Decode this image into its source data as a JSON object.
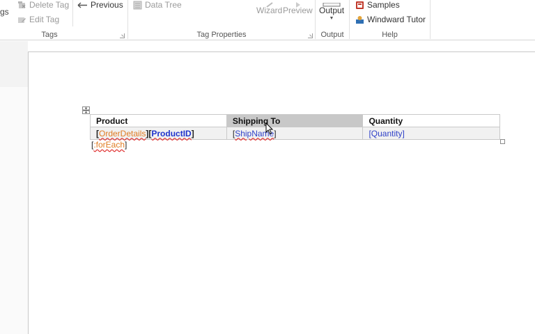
{
  "ribbon": {
    "tags_group": {
      "label": "Tags",
      "partial_left_label": "gs",
      "delete_tag": "Delete Tag",
      "edit_tag": "Edit Tag",
      "previous": "Previous"
    },
    "tag_properties_group": {
      "label": "Tag Properties",
      "data_tree": "Data Tree",
      "wizard": "Wizard",
      "preview": "Preview"
    },
    "output_group": {
      "label": "Output",
      "output_button": "Output"
    },
    "help_group": {
      "label": "Help",
      "samples": "Samples",
      "windward_tutor": "Windward Tutor"
    }
  },
  "document": {
    "table": {
      "headers": [
        "Product",
        "Shipping To",
        "Quantity"
      ],
      "selected_header_index": 1,
      "row": {
        "product_tag1": "OrderDetails",
        "product_tag2": "ProductID",
        "shipping_tag": "ShipName",
        "quantity_tag": "Quantity"
      }
    },
    "foreach_tag": ":forEach"
  },
  "colors": {
    "tag_orange": "#e07b22",
    "tag_blue": "#1f33cc",
    "selection_gray": "#c8c8c8",
    "spell_underline": "#e03030"
  }
}
